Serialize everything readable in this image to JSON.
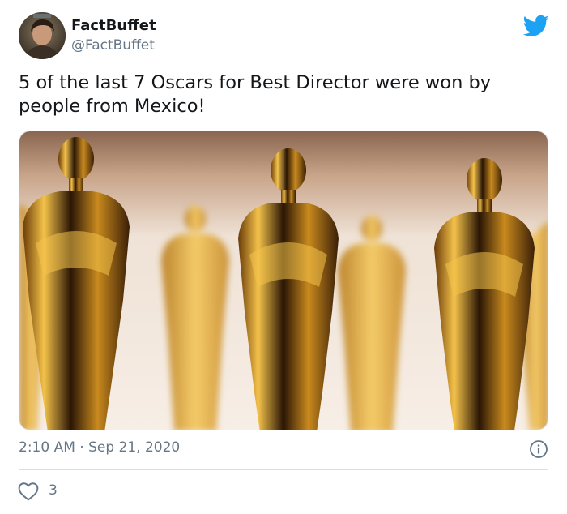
{
  "author": {
    "name": "FactBuffet",
    "handle": "@FactBuffet"
  },
  "tweet": {
    "text": "5 of the last 7 Oscars for Best Director were won by people from Mexico!",
    "timestamp": "2:10 AM · Sep 21, 2020",
    "like_count": "3"
  },
  "icons": {
    "brand": "twitter-bird-icon",
    "info": "info-icon",
    "like": "heart-icon"
  },
  "colors": {
    "brand": "#1da1f2",
    "secondary_text": "#657786"
  }
}
